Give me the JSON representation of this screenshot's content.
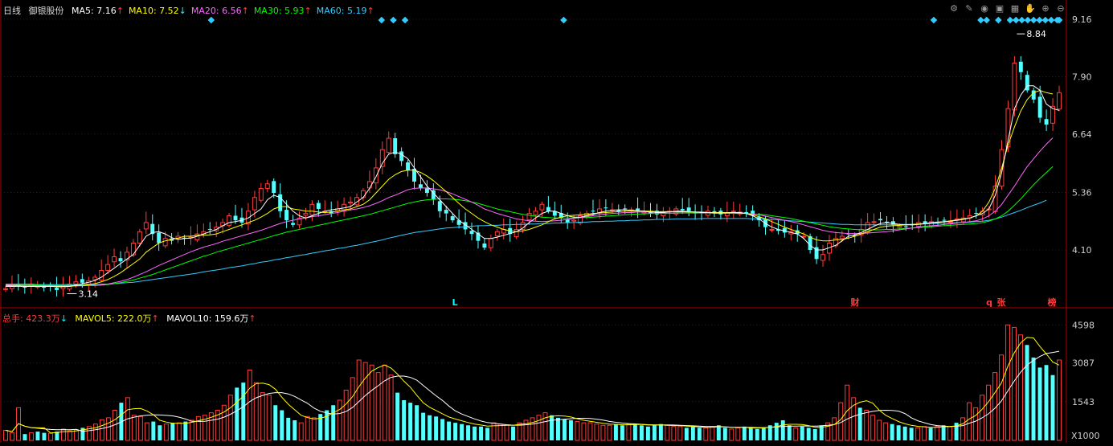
{
  "header": {
    "period": "日线",
    "stock": "御银股份",
    "ma": [
      {
        "label": "MA5: 7.16",
        "arrow": "↑",
        "color": "#ffffff",
        "arrowColor": "#ff3b3b"
      },
      {
        "label": "MA10: 7.52",
        "arrow": "↓",
        "color": "#ffff00",
        "arrowColor": "#00ffff"
      },
      {
        "label": "MA20: 6.56",
        "arrow": "↑",
        "color": "#ff66ff",
        "arrowColor": "#ff3b3b"
      },
      {
        "label": "MA30: 5.93",
        "arrow": "↑",
        "color": "#00ff00",
        "arrowColor": "#ff3b3b"
      },
      {
        "label": "MA60: 5.19",
        "arrow": "↑",
        "color": "#33ccff",
        "arrowColor": "#ff3b3b"
      }
    ]
  },
  "toolbar": [
    "settings-icon",
    "brush-icon",
    "eye-icon",
    "briefcase-icon",
    "chart-icon",
    "hand-icon",
    "zoom-in-icon",
    "zoom-out-icon"
  ],
  "vol_header": {
    "total": "总手: 423.3万",
    "total_arrow": "↓",
    "mavol5": "MAVOL5: 222.0万",
    "mavol5_arrow": "↑",
    "mavol10": "MAVOL10: 159.6万",
    "mavol10_arrow": "↑"
  },
  "price_axis": [
    "9.16",
    "7.90",
    "6.64",
    "5.36",
    "4.10"
  ],
  "vol_axis": [
    "4598",
    "3087",
    "1543"
  ],
  "vol_unit": "X1000",
  "annotations": {
    "high": "8.84",
    "low": "3.14"
  },
  "markers": [
    {
      "text": "L",
      "color": "#00ffff"
    },
    {
      "text": "财",
      "color": "#ff3b3b"
    },
    {
      "text": "q",
      "color": "#ff3b3b"
    },
    {
      "text": "张",
      "color": "#ff3b3b"
    },
    {
      "text": "榜",
      "color": "#ff3b3b"
    }
  ],
  "colors": {
    "up": "#ff3b3b",
    "down": "#54ffff",
    "grid": "#7a0000",
    "axis": "#b00000"
  },
  "chart_data": [
    {
      "type": "candlestick",
      "title": "",
      "ylim": [
        3.0,
        9.5
      ],
      "price_ticks": [
        9.16,
        7.9,
        6.64,
        5.36,
        4.1
      ],
      "high": 8.84,
      "low": 3.14,
      "ma_last": {
        "MA5": 7.16,
        "MA10": 7.52,
        "MA20": 6.56,
        "MA30": 5.93,
        "MA60": 5.19
      },
      "closes": [
        3.25,
        3.3,
        3.32,
        3.28,
        3.35,
        3.3,
        3.27,
        3.3,
        3.22,
        3.3,
        3.35,
        3.4,
        3.38,
        3.42,
        3.5,
        3.65,
        3.78,
        3.95,
        3.85,
        4.05,
        4.25,
        4.5,
        4.7,
        4.45,
        4.25,
        4.35,
        4.3,
        4.4,
        4.35,
        4.38,
        4.45,
        4.5,
        4.55,
        4.6,
        4.7,
        4.85,
        4.75,
        4.7,
        4.95,
        5.25,
        5.45,
        5.55,
        5.35,
        4.95,
        4.75,
        4.65,
        4.8,
        4.9,
        5.1,
        5.0,
        4.95,
        4.9,
        5.0,
        5.1,
        5.15,
        5.25,
        5.4,
        5.6,
        5.9,
        6.3,
        6.55,
        6.2,
        6.05,
        5.85,
        5.6,
        5.45,
        5.35,
        5.2,
        4.95,
        4.9,
        4.75,
        4.65,
        4.55,
        4.45,
        4.3,
        4.15,
        4.35,
        4.5,
        4.55,
        4.45,
        4.55,
        4.7,
        4.9,
        4.95,
        5.1,
        4.95,
        4.85,
        4.8,
        4.7,
        4.75,
        4.85,
        4.9,
        4.95,
        5.0,
        5.02,
        4.98,
        4.95,
        5.0,
        4.98,
        4.97,
        4.95,
        4.9,
        4.88,
        4.92,
        4.95,
        5.0,
        4.97,
        4.95,
        4.9,
        4.92,
        4.95,
        4.9,
        4.88,
        4.92,
        4.95,
        4.93,
        4.9,
        4.85,
        4.75,
        4.6,
        4.55,
        4.52,
        4.48,
        4.5,
        4.45,
        4.4,
        4.1,
        3.9,
        4.0,
        4.25,
        4.35,
        4.4,
        4.45,
        4.4,
        4.55,
        4.7,
        4.72,
        4.75,
        4.7,
        4.65,
        4.62,
        4.6,
        4.65,
        4.7,
        4.68,
        4.72,
        4.7,
        4.75,
        4.72,
        4.78,
        4.8,
        4.85,
        4.9,
        4.95,
        5.0,
        5.5,
        6.3,
        7.2,
        8.2,
        8.0,
        7.6,
        7.4,
        7.0,
        6.85,
        7.25,
        7.55
      ],
      "ma5": [
        3.3,
        3.3,
        3.3,
        3.3,
        3.3,
        3.3,
        3.3,
        3.3,
        3.29,
        3.29,
        3.3,
        3.33,
        3.36,
        3.39,
        3.43,
        3.5,
        3.6,
        3.7,
        3.8,
        3.9,
        4.0,
        4.2,
        4.4,
        4.48,
        4.5,
        4.45,
        4.37,
        4.33,
        4.35,
        4.36,
        4.4,
        4.45,
        4.5,
        4.55,
        4.63,
        4.7,
        4.72,
        4.75,
        4.8,
        4.9,
        5.0,
        5.2,
        5.3,
        5.25,
        5.1,
        4.95,
        4.85,
        4.8,
        4.85,
        4.9,
        4.95,
        4.98,
        5.0,
        5.02,
        5.05,
        5.15,
        5.25,
        5.45,
        5.7,
        6.0,
        6.2,
        6.25,
        6.2,
        6.1,
        5.9,
        5.7,
        5.5,
        5.35,
        5.2,
        5.05,
        4.9,
        4.75,
        4.65,
        4.55,
        4.45,
        4.35,
        4.35,
        4.38,
        4.42,
        4.46,
        4.5,
        4.58,
        4.7,
        4.8,
        4.9,
        4.95,
        4.95,
        4.9,
        4.85,
        4.82,
        4.82,
        4.85,
        4.88,
        4.92,
        4.95,
        4.97,
        4.98,
        4.98,
        4.97,
        4.96,
        4.95,
        4.93,
        4.92,
        4.92,
        4.93,
        4.95,
        4.95,
        4.94,
        4.93,
        4.92,
        4.92,
        4.91,
        4.91,
        4.91,
        4.92,
        4.92,
        4.9,
        4.85,
        4.78,
        4.68,
        4.6,
        4.55,
        4.52,
        4.48,
        4.45,
        4.35,
        4.2,
        4.1,
        4.1,
        4.15,
        4.2,
        4.3,
        4.4,
        4.43,
        4.48,
        4.55,
        4.62,
        4.68,
        4.7,
        4.68,
        4.66,
        4.65,
        4.65,
        4.66,
        4.68,
        4.7,
        4.71,
        4.72,
        4.73,
        4.75,
        4.77,
        4.8,
        4.85,
        4.9,
        5.0,
        5.3,
        5.8,
        6.5,
        7.2,
        7.5,
        7.7,
        7.7,
        7.6,
        7.3,
        7.2,
        7.16
      ],
      "ma10": [
        3.32,
        3.31,
        3.31,
        3.3,
        3.3,
        3.3,
        3.3,
        3.3,
        3.3,
        3.3,
        3.3,
        3.31,
        3.32,
        3.34,
        3.36,
        3.4,
        3.45,
        3.52,
        3.6,
        3.7,
        3.8,
        3.9,
        4.05,
        4.15,
        4.25,
        4.3,
        4.33,
        4.36,
        4.4,
        4.4,
        4.42,
        4.42,
        4.43,
        4.45,
        4.5,
        4.55,
        4.6,
        4.65,
        4.7,
        4.75,
        4.82,
        4.9,
        5.0,
        5.05,
        5.05,
        5.0,
        4.98,
        4.95,
        4.95,
        4.93,
        4.92,
        4.93,
        4.95,
        4.98,
        5.0,
        5.05,
        5.1,
        5.2,
        5.35,
        5.5,
        5.65,
        5.75,
        5.82,
        5.85,
        5.85,
        5.8,
        5.72,
        5.62,
        5.5,
        5.38,
        5.25,
        5.12,
        5.0,
        4.9,
        4.8,
        4.72,
        4.65,
        4.6,
        4.55,
        4.52,
        4.5,
        4.52,
        4.55,
        4.6,
        4.65,
        4.72,
        4.78,
        4.82,
        4.85,
        4.86,
        4.87,
        4.88,
        4.9,
        4.91,
        4.92,
        4.93,
        4.94,
        4.95,
        4.95,
        4.95,
        4.95,
        4.95,
        4.94,
        4.94,
        4.94,
        4.94,
        4.94,
        4.93,
        4.93,
        4.93,
        4.92,
        4.92,
        4.92,
        4.92,
        4.92,
        4.91,
        4.9,
        4.87,
        4.83,
        4.78,
        4.72,
        4.66,
        4.6,
        4.55,
        4.5,
        4.45,
        4.38,
        4.32,
        4.3,
        4.3,
        4.32,
        4.33,
        4.36,
        4.4,
        4.45,
        4.5,
        4.55,
        4.6,
        4.62,
        4.63,
        4.64,
        4.65,
        4.66,
        4.67,
        4.68,
        4.69,
        4.7,
        4.72,
        4.74,
        4.76,
        4.78,
        4.8,
        4.85,
        4.95,
        5.15,
        5.45,
        5.9,
        6.4,
        6.8,
        7.15,
        7.4,
        7.55,
        7.6,
        7.55,
        7.52
      ],
      "ma20": [
        3.33,
        3.33,
        3.32,
        3.32,
        3.32,
        3.31,
        3.31,
        3.31,
        3.31,
        3.31,
        3.31,
        3.31,
        3.31,
        3.32,
        3.32,
        3.33,
        3.35,
        3.38,
        3.41,
        3.45,
        3.5,
        3.56,
        3.62,
        3.69,
        3.76,
        3.82,
        3.88,
        3.94,
        4.0,
        4.06,
        4.11,
        4.16,
        4.2,
        4.24,
        4.29,
        4.33,
        4.37,
        4.41,
        4.45,
        4.49,
        4.53,
        4.58,
        4.63,
        4.68,
        4.72,
        4.75,
        4.78,
        4.8,
        4.83,
        4.85,
        4.87,
        4.9,
        4.92,
        4.95,
        4.98,
        5.0,
        5.03,
        5.07,
        5.12,
        5.18,
        5.25,
        5.3,
        5.36,
        5.42,
        5.45,
        5.46,
        5.46,
        5.44,
        5.42,
        5.38,
        5.33,
        5.27,
        5.21,
        5.15,
        5.08,
        5.0,
        4.95,
        4.9,
        4.86,
        4.82,
        4.78,
        4.76,
        4.74,
        4.73,
        4.72,
        4.73,
        4.74,
        4.75,
        4.77,
        4.79,
        4.81,
        4.83,
        4.85,
        4.87,
        4.89,
        4.9,
        4.91,
        4.92,
        4.92,
        4.93,
        4.93,
        4.93,
        4.93,
        4.93,
        4.93,
        4.93,
        4.93,
        4.93,
        4.93,
        4.93,
        4.92,
        4.92,
        4.92,
        4.92,
        4.91,
        4.91,
        4.9,
        4.89,
        4.87,
        4.84,
        4.81,
        4.78,
        4.75,
        4.72,
        4.69,
        4.65,
        4.61,
        4.57,
        4.53,
        4.5,
        4.48,
        4.47,
        4.46,
        4.46,
        4.46,
        4.47,
        4.48,
        4.49,
        4.5,
        4.52,
        4.54,
        4.56,
        4.58,
        4.6,
        4.62,
        4.63,
        4.64,
        4.66,
        4.67,
        4.69,
        4.7,
        4.72,
        4.74,
        4.78,
        4.85,
        4.95,
        5.1,
        5.3,
        5.5,
        5.72,
        5.93,
        6.1,
        6.27,
        6.42,
        6.56
      ],
      "ma30": [
        3.34,
        3.34,
        3.33,
        3.33,
        3.33,
        3.33,
        3.32,
        3.32,
        3.32,
        3.32,
        3.32,
        3.32,
        3.32,
        3.32,
        3.32,
        3.33,
        3.34,
        3.36,
        3.38,
        3.41,
        3.44,
        3.48,
        3.52,
        3.56,
        3.61,
        3.66,
        3.71,
        3.76,
        3.81,
        3.86,
        3.91,
        3.96,
        4.0,
        4.05,
        4.09,
        4.13,
        4.17,
        4.21,
        4.25,
        4.29,
        4.33,
        4.37,
        4.41,
        4.45,
        4.49,
        4.52,
        4.55,
        4.58,
        4.61,
        4.64,
        4.67,
        4.7,
        4.73,
        4.76,
        4.79,
        4.82,
        4.85,
        4.88,
        4.92,
        4.96,
        5.0,
        5.04,
        5.08,
        5.12,
        5.15,
        5.18,
        5.2,
        5.21,
        5.22,
        5.22,
        5.21,
        5.2,
        5.18,
        5.15,
        5.12,
        5.08,
        5.04,
        5.0,
        4.97,
        4.94,
        4.91,
        4.88,
        4.86,
        4.84,
        4.82,
        4.81,
        4.8,
        4.8,
        4.8,
        4.8,
        4.81,
        4.81,
        4.82,
        4.83,
        4.84,
        4.85,
        4.86,
        4.87,
        4.88,
        4.89,
        4.89,
        4.9,
        4.9,
        4.9,
        4.9,
        4.91,
        4.91,
        4.91,
        4.91,
        4.91,
        4.91,
        4.91,
        4.91,
        4.91,
        4.9,
        4.9,
        4.9,
        4.89,
        4.88,
        4.87,
        4.85,
        4.83,
        4.81,
        4.79,
        4.76,
        4.73,
        4.7,
        4.67,
        4.64,
        4.61,
        4.59,
        4.57,
        4.56,
        4.55,
        4.54,
        4.54,
        4.54,
        4.54,
        4.55,
        4.55,
        4.56,
        4.57,
        4.58,
        4.59,
        4.6,
        4.61,
        4.62,
        4.63,
        4.64,
        4.65,
        4.66,
        4.67,
        4.68,
        4.7,
        4.73,
        4.78,
        4.85,
        4.95,
        5.08,
        5.22,
        5.38,
        5.53,
        5.67,
        5.8,
        5.93
      ],
      "ma60": [
        3.35,
        3.35,
        3.35,
        3.35,
        3.35,
        3.34,
        3.34,
        3.34,
        3.34,
        3.34,
        3.34,
        3.34,
        3.34,
        3.34,
        3.34,
        3.35,
        3.35,
        3.36,
        3.37,
        3.38,
        3.39,
        3.41,
        3.43,
        3.45,
        3.47,
        3.49,
        3.51,
        3.53,
        3.55,
        3.57,
        3.59,
        3.62,
        3.64,
        3.66,
        3.68,
        3.71,
        3.73,
        3.75,
        3.78,
        3.8,
        3.83,
        3.85,
        3.88,
        3.9,
        3.93,
        3.95,
        3.98,
        4.0,
        4.03,
        4.05,
        4.08,
        4.1,
        4.13,
        4.15,
        4.18,
        4.2,
        4.23,
        4.26,
        4.29,
        4.32,
        4.36,
        4.39,
        4.42,
        4.45,
        4.48,
        4.5,
        4.52,
        4.54,
        4.56,
        4.58,
        4.59,
        4.6,
        4.61,
        4.62,
        4.63,
        4.63,
        4.64,
        4.64,
        4.65,
        4.65,
        4.66,
        4.66,
        4.67,
        4.67,
        4.68,
        4.68,
        4.69,
        4.69,
        4.7,
        4.7,
        4.71,
        4.71,
        4.72,
        4.72,
        4.73,
        4.73,
        4.74,
        4.74,
        4.75,
        4.75,
        4.76,
        4.76,
        4.77,
        4.77,
        4.77,
        4.78,
        4.78,
        4.78,
        4.78,
        4.79,
        4.79,
        4.79,
        4.79,
        4.79,
        4.79,
        4.79,
        4.79,
        4.78,
        4.78,
        4.77,
        4.77,
        4.76,
        4.75,
        4.74,
        4.73,
        4.72,
        4.71,
        4.7,
        4.69,
        4.68,
        4.67,
        4.66,
        4.66,
        4.65,
        4.65,
        4.65,
        4.65,
        4.65,
        4.65,
        4.65,
        4.66,
        4.66,
        4.66,
        4.67,
        4.67,
        4.68,
        4.68,
        4.69,
        4.69,
        4.7,
        4.7,
        4.71,
        4.72,
        4.73,
        4.75,
        4.78,
        4.82,
        4.87,
        4.92,
        4.97,
        5.03,
        5.08,
        5.13,
        5.19
      ]
    },
    {
      "type": "bar",
      "title": "",
      "unit": "X1000",
      "ylim": [
        0,
        4800
      ],
      "ticks": [
        4598,
        3087,
        1543
      ],
      "volumes": [
        400,
        300,
        1300,
        250,
        300,
        350,
        300,
        280,
        350,
        450,
        380,
        420,
        500,
        550,
        650,
        820,
        900,
        1200,
        1500,
        1700,
        1000,
        950,
        700,
        750,
        600,
        650,
        700,
        700,
        750,
        800,
        950,
        1000,
        1100,
        1200,
        1400,
        1800,
        2100,
        2300,
        2800,
        2300,
        1900,
        1800,
        1400,
        1200,
        900,
        800,
        700,
        950,
        900,
        1050,
        1200,
        1400,
        1600,
        2000,
        2500,
        3200,
        3100,
        3000,
        2700,
        3000,
        2600,
        1900,
        1600,
        1500,
        1400,
        1100,
        1000,
        950,
        850,
        750,
        700,
        650,
        600,
        550,
        550,
        500,
        700,
        650,
        600,
        550,
        700,
        800,
        900,
        1000,
        1100,
        1000,
        900,
        850,
        800,
        750,
        700,
        700,
        650,
        600,
        600,
        650,
        600,
        650,
        650,
        600,
        550,
        600,
        650,
        600,
        550,
        550,
        500,
        550,
        500,
        500,
        550,
        600,
        500,
        450,
        500,
        550,
        500,
        450,
        500,
        600,
        700,
        800,
        600,
        500,
        550,
        500,
        450,
        600,
        700,
        900,
        1500,
        2200,
        1700,
        1300,
        1200,
        1000,
        800,
        700,
        650,
        600,
        550,
        500,
        500,
        550,
        500,
        550,
        600,
        550,
        700,
        900,
        1500,
        1300,
        1800,
        2200,
        2700,
        3400,
        4600,
        4500,
        4200,
        3800,
        3300,
        2900,
        3000,
        2600,
        3200
      ],
      "mavol5_last": 222.0,
      "mavol10_last": 159.6
    }
  ]
}
